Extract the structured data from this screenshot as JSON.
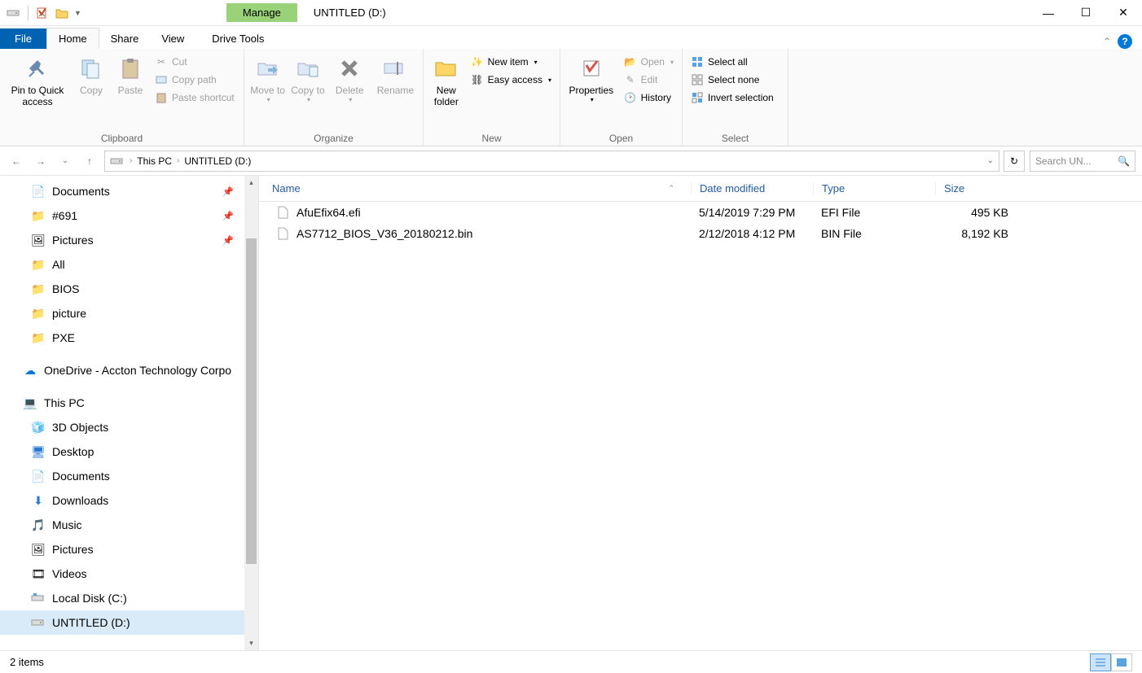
{
  "titlebar": {
    "context_tab": "Manage",
    "window_title": "UNTITLED (D:)"
  },
  "tabs": {
    "file": "File",
    "home": "Home",
    "share": "Share",
    "view": "View",
    "drive_tools": "Drive Tools"
  },
  "ribbon": {
    "clipboard": {
      "label": "Clipboard",
      "pin": "Pin to Quick access",
      "copy": "Copy",
      "paste": "Paste",
      "cut": "Cut",
      "copy_path": "Copy path",
      "paste_shortcut": "Paste shortcut"
    },
    "organize": {
      "label": "Organize",
      "move_to": "Move to",
      "copy_to": "Copy to",
      "delete": "Delete",
      "rename": "Rename"
    },
    "new": {
      "label": "New",
      "new_folder": "New folder",
      "new_item": "New item",
      "easy_access": "Easy access"
    },
    "open": {
      "label": "Open",
      "properties": "Properties",
      "open": "Open",
      "edit": "Edit",
      "history": "History"
    },
    "select": {
      "label": "Select",
      "select_all": "Select all",
      "select_none": "Select none",
      "invert": "Invert selection"
    }
  },
  "breadcrumb": {
    "this_pc": "This PC",
    "loc": "UNTITLED (D:)"
  },
  "search_placeholder": "Search UN...",
  "nav": {
    "documents": "Documents",
    "f691": "#691",
    "pictures": "Pictures",
    "all": "All",
    "bios": "BIOS",
    "picture": "picture",
    "pxe": "PXE",
    "onedrive": "OneDrive - Accton Technology Corpo",
    "this_pc": "This PC",
    "objects3d": "3D Objects",
    "desktop": "Desktop",
    "documents2": "Documents",
    "downloads": "Downloads",
    "music": "Music",
    "pictures2": "Pictures",
    "videos": "Videos",
    "local_c": "Local Disk (C:)",
    "untitled_d": "UNTITLED (D:)"
  },
  "columns": {
    "name": "Name",
    "date": "Date modified",
    "type": "Type",
    "size": "Size"
  },
  "files": [
    {
      "name": "AfuEfix64.efi",
      "date": "5/14/2019 7:29 PM",
      "type": "EFI File",
      "size": "495 KB"
    },
    {
      "name": "AS7712_BIOS_V36_20180212.bin",
      "date": "2/12/2018 4:12 PM",
      "type": "BIN File",
      "size": "8,192 KB"
    }
  ],
  "status": "2 items"
}
